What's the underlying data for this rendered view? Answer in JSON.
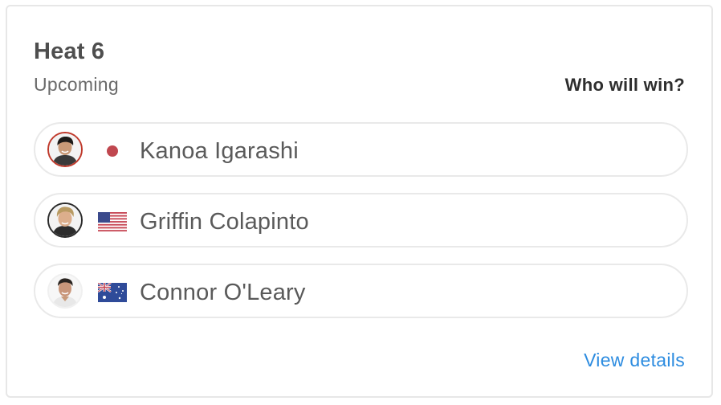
{
  "heat": {
    "title": "Heat 6",
    "status": "Upcoming",
    "prompt": "Who will win?",
    "details_link": "View details"
  },
  "surfers": [
    {
      "name": "Kanoa Igarashi",
      "flag": "japan-flag-icon",
      "selected": true
    },
    {
      "name": "Griffin Colapinto",
      "flag": "usa-flag-icon",
      "selected": false
    },
    {
      "name": "Connor O'Leary",
      "flag": "australia-flag-icon",
      "selected": false
    }
  ],
  "colors": {
    "title": "#4e4e4e",
    "name": "#5a5a5a",
    "link": "#2d8ce0",
    "selected_ring": "#c0392b",
    "japan_dot": "#c0474f"
  }
}
